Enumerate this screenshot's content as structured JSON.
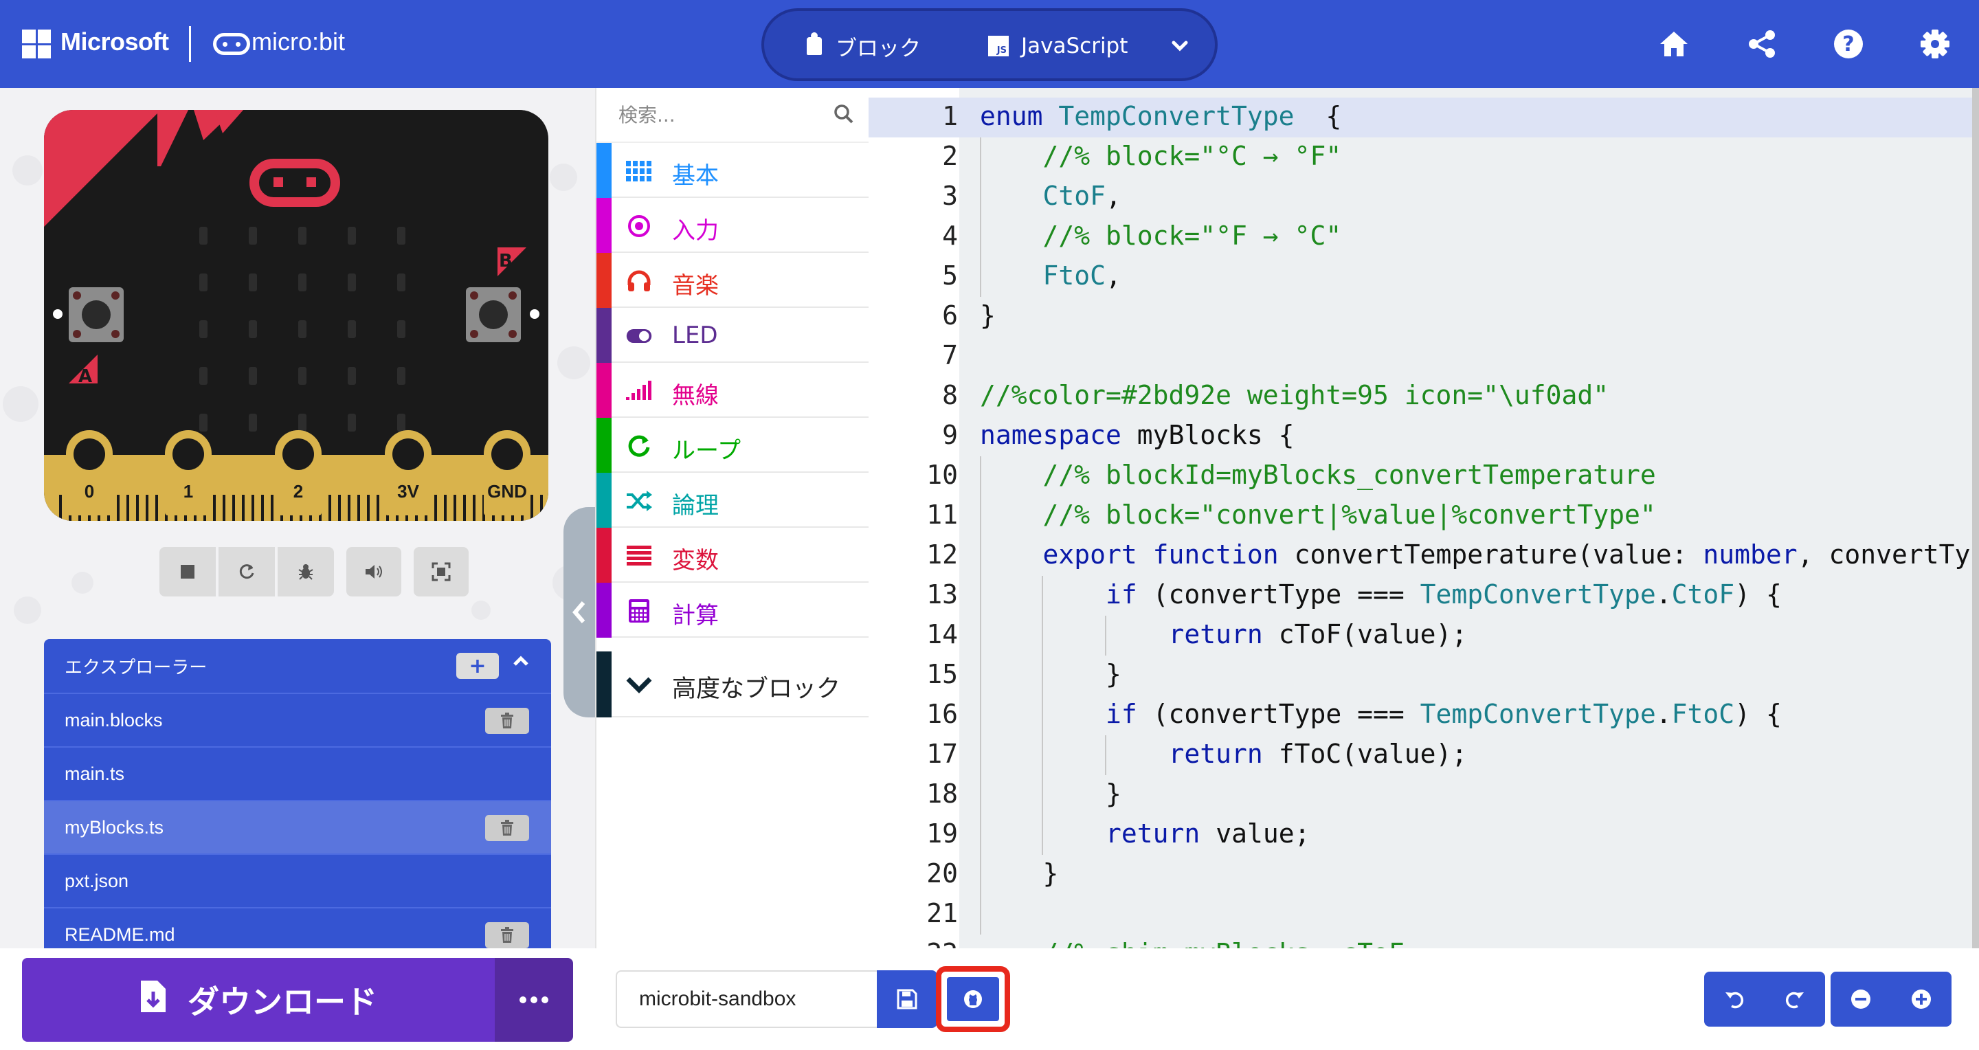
{
  "header": {
    "brand": "Microsoft",
    "product": "micro:bit",
    "tabs": {
      "blocks": "ブロック",
      "javascript": "JavaScript",
      "js_badge": "JS"
    },
    "icons": [
      "home-icon",
      "share-icon",
      "help-icon",
      "settings-icon"
    ],
    "color": "#3454d1"
  },
  "simulator": {
    "buttons": {
      "a": "A",
      "b": "B"
    },
    "pins": [
      "0",
      "1",
      "2",
      "3V",
      "GND"
    ],
    "toolbar_icons": [
      "stop-icon",
      "restart-icon",
      "debug-icon",
      "sound-icon",
      "fullscreen-icon"
    ]
  },
  "explorer": {
    "title": "エクスプローラー",
    "files": [
      {
        "name": "main.blocks",
        "deletable": true,
        "selected": false
      },
      {
        "name": "main.ts",
        "deletable": false,
        "selected": false
      },
      {
        "name": "myBlocks.ts",
        "deletable": true,
        "selected": true
      },
      {
        "name": "pxt.json",
        "deletable": false,
        "selected": false
      },
      {
        "name": "README.md",
        "deletable": true,
        "selected": false
      }
    ]
  },
  "toolbox": {
    "search_placeholder": "検索...",
    "categories": [
      {
        "label": "基本",
        "color": "#1e90ff",
        "icon": "grid-icon"
      },
      {
        "label": "入力",
        "color": "#d400d4",
        "icon": "target-icon"
      },
      {
        "label": "音楽",
        "color": "#e63022",
        "icon": "headphones-icon"
      },
      {
        "label": "LED",
        "color": "#5c2d91",
        "icon": "toggle-icon"
      },
      {
        "label": "無線",
        "color": "#e3008c",
        "icon": "signal-icon"
      },
      {
        "label": "ループ",
        "color": "#00aa00",
        "icon": "loop-icon"
      },
      {
        "label": "論理",
        "color": "#00a4a6",
        "icon": "shuffle-icon"
      },
      {
        "label": "変数",
        "color": "#dc143c",
        "icon": "list-icon"
      },
      {
        "label": "計算",
        "color": "#9400d3",
        "icon": "calculator-icon"
      }
    ],
    "advanced": "高度なブロック"
  },
  "editor": {
    "lines": [
      {
        "n": "1",
        "t": [
          [
            "kw",
            "enum "
          ],
          [
            "type",
            "TempConvertType"
          ],
          [
            "",
            "  {"
          ]
        ]
      },
      {
        "n": "2",
        "t": [
          [
            "",
            "    "
          ],
          [
            "com",
            "//% block=\"°C → °F\""
          ]
        ]
      },
      {
        "n": "3",
        "t": [
          [
            "",
            "    "
          ],
          [
            "type",
            "CtoF"
          ],
          [
            "",
            ","
          ]
        ]
      },
      {
        "n": "4",
        "t": [
          [
            "",
            "    "
          ],
          [
            "com",
            "//% block=\"°F → °C\""
          ]
        ]
      },
      {
        "n": "5",
        "t": [
          [
            "",
            "    "
          ],
          [
            "type",
            "FtoC"
          ],
          [
            "",
            ","
          ]
        ]
      },
      {
        "n": "6",
        "t": [
          [
            "",
            "}"
          ]
        ]
      },
      {
        "n": "7",
        "t": []
      },
      {
        "n": "8",
        "t": [
          [
            "com",
            "//%color=#2bd92e weight=95 icon=\"\\uf0ad\""
          ]
        ]
      },
      {
        "n": "9",
        "t": [
          [
            "kw",
            "namespace"
          ],
          [
            "",
            " myBlocks {"
          ]
        ]
      },
      {
        "n": "10",
        "t": [
          [
            "",
            "    "
          ],
          [
            "com",
            "//% blockId=myBlocks_convertTemperature"
          ]
        ]
      },
      {
        "n": "11",
        "t": [
          [
            "",
            "    "
          ],
          [
            "com",
            "//% block=\"convert|%value|%convertType\""
          ]
        ]
      },
      {
        "n": "12",
        "t": [
          [
            "",
            "    "
          ],
          [
            "kw",
            "export function"
          ],
          [
            "",
            " convertTemperature(value: "
          ],
          [
            "kw",
            "number"
          ],
          [
            "",
            ", convertTyp"
          ]
        ]
      },
      {
        "n": "13",
        "t": [
          [
            "",
            "        "
          ],
          [
            "kw",
            "if"
          ],
          [
            "",
            " (convertType === "
          ],
          [
            "type",
            "TempConvertType"
          ],
          [
            "",
            "."
          ],
          [
            "type",
            "CtoF"
          ],
          [
            "",
            ") {"
          ]
        ]
      },
      {
        "n": "14",
        "t": [
          [
            "",
            "            "
          ],
          [
            "kw",
            "return"
          ],
          [
            "",
            " cToF(value);"
          ]
        ]
      },
      {
        "n": "15",
        "t": [
          [
            "",
            "        }"
          ]
        ]
      },
      {
        "n": "16",
        "t": [
          [
            "",
            "        "
          ],
          [
            "kw",
            "if"
          ],
          [
            "",
            " (convertType === "
          ],
          [
            "type",
            "TempConvertType"
          ],
          [
            "",
            "."
          ],
          [
            "type",
            "FtoC"
          ],
          [
            "",
            ") {"
          ]
        ]
      },
      {
        "n": "17",
        "t": [
          [
            "",
            "            "
          ],
          [
            "kw",
            "return"
          ],
          [
            "",
            " fToC(value);"
          ]
        ]
      },
      {
        "n": "18",
        "t": [
          [
            "",
            "        }"
          ]
        ]
      },
      {
        "n": "19",
        "t": [
          [
            "",
            "        "
          ],
          [
            "kw",
            "return"
          ],
          [
            "",
            " value;"
          ]
        ]
      },
      {
        "n": "20",
        "t": [
          [
            "",
            "    }"
          ]
        ]
      },
      {
        "n": "21",
        "t": []
      },
      {
        "n": "22",
        "t": [
          [
            "",
            "    "
          ],
          [
            "com",
            "//% shim=myBlocks::cToF"
          ]
        ]
      }
    ]
  },
  "bottombar": {
    "download": "ダウンロード",
    "project_name": "microbit-sandbox",
    "icons": [
      "save-icon",
      "github-icon",
      "undo-icon",
      "redo-icon",
      "zoom-out-icon",
      "zoom-in-icon"
    ]
  }
}
